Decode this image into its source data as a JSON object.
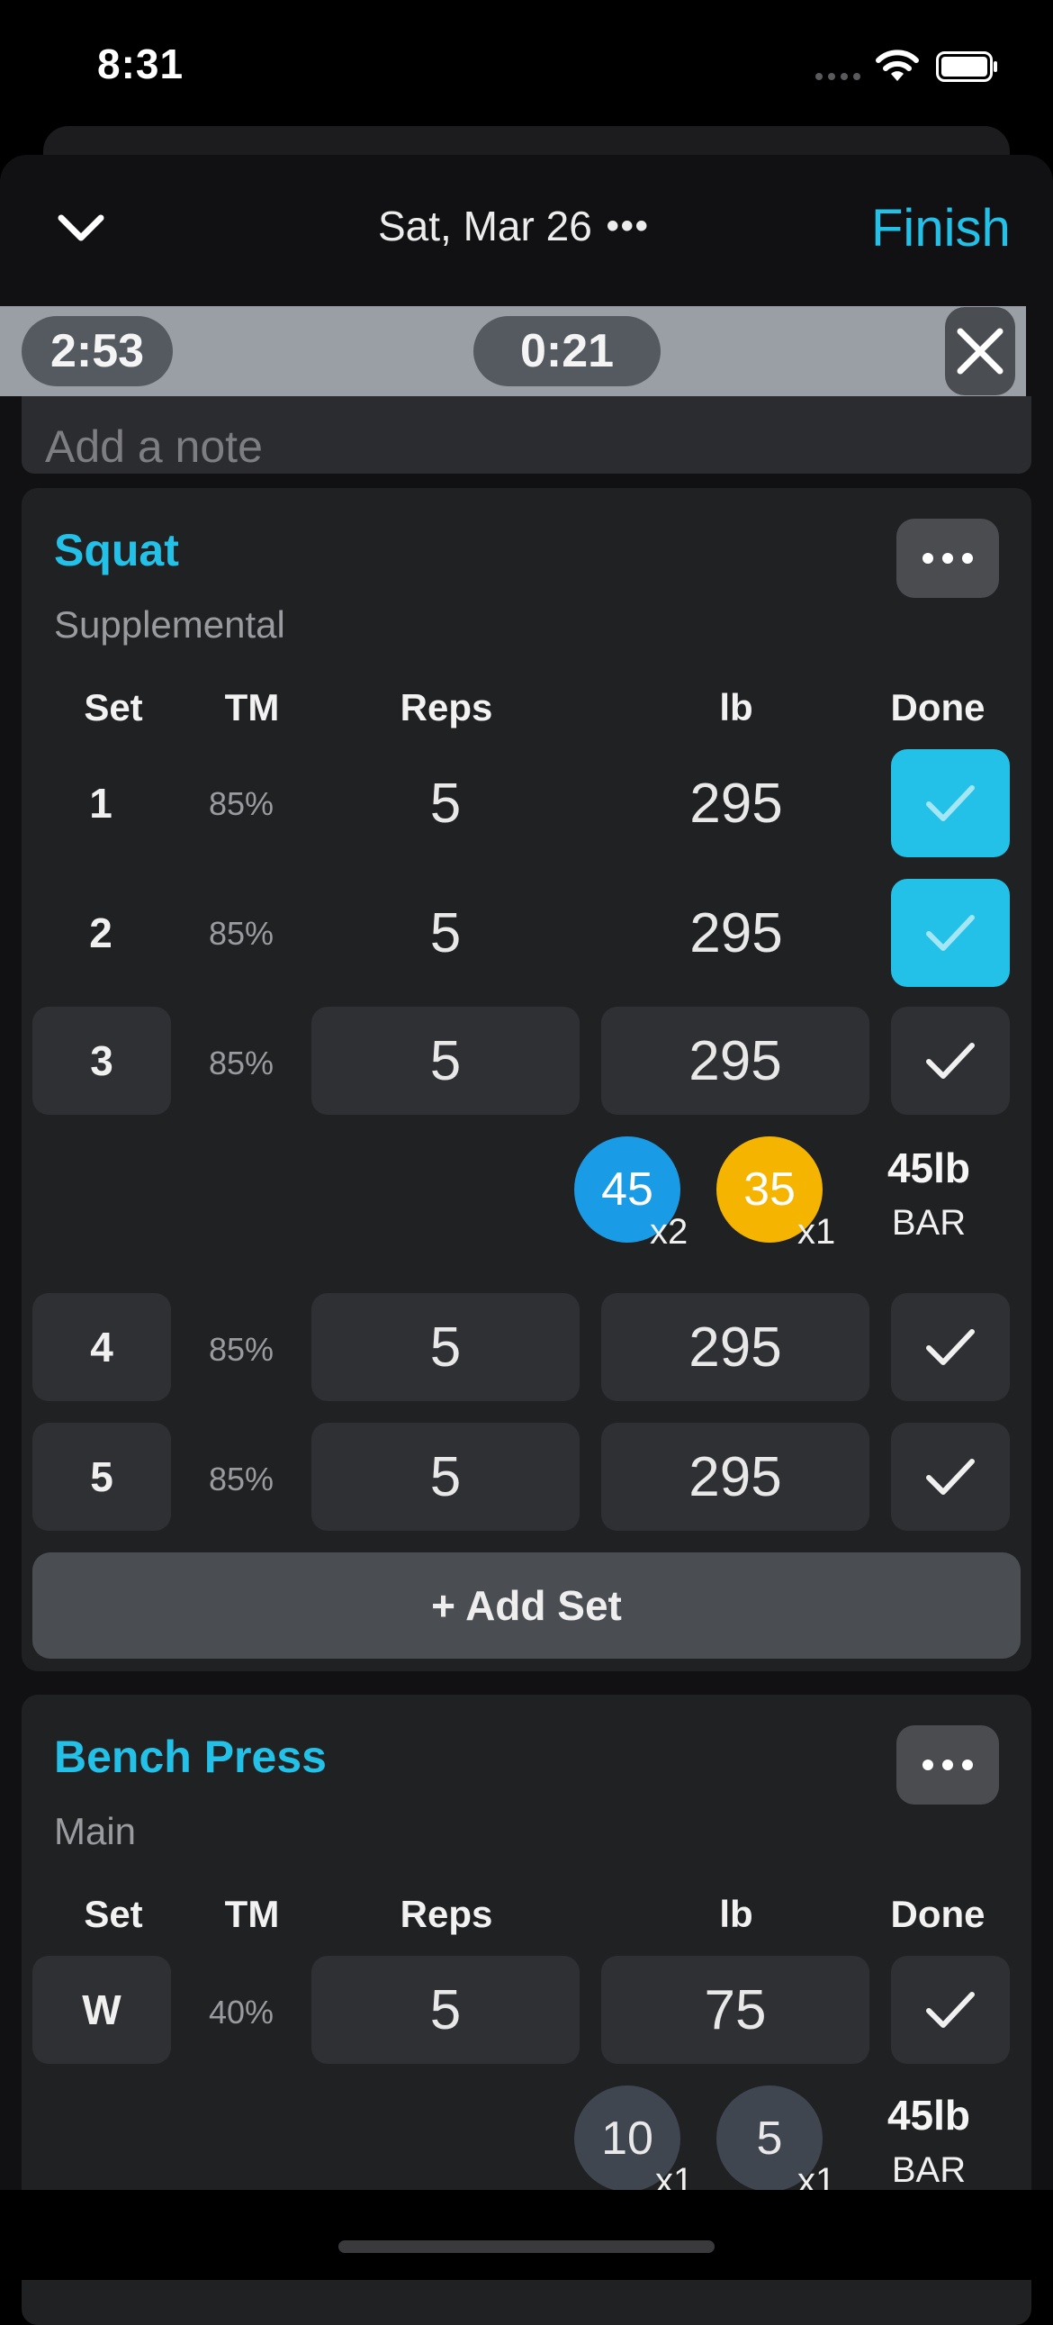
{
  "status": {
    "time": "8:31"
  },
  "header": {
    "date": "Sat, Mar 26",
    "more_glyph": "•••",
    "finish_label": "Finish",
    "collapse_icon": "chevron-down-icon"
  },
  "timers": {
    "elapsed": "2:53",
    "rest": "0:21",
    "close_icon": "close-icon"
  },
  "note": {
    "placeholder": "Add a note"
  },
  "columns": {
    "set": "Set",
    "tm": "TM",
    "reps": "Reps",
    "weight": "lb",
    "done": "Done"
  },
  "exercises": [
    {
      "name": "Squat",
      "type": "Supplemental",
      "sets": [
        {
          "set": "1",
          "tm": "85%",
          "reps": "5",
          "weight": "295",
          "done": true
        },
        {
          "set": "2",
          "tm": "85%",
          "reps": "5",
          "weight": "295",
          "done": true
        },
        {
          "set": "3",
          "tm": "85%",
          "reps": "5",
          "weight": "295",
          "done": false
        },
        {
          "set": "4",
          "tm": "85%",
          "reps": "5",
          "weight": "295",
          "done": false
        },
        {
          "set": "5",
          "tm": "85%",
          "reps": "5",
          "weight": "295",
          "done": false
        }
      ],
      "plates": [
        {
          "weight": "45",
          "count": "x2",
          "color": "#1a9be6"
        },
        {
          "weight": "35",
          "count": "x1",
          "color": "#f5b400"
        }
      ],
      "bar": {
        "weight": "45lb",
        "label": "BAR"
      },
      "add_set_label": "+ Add Set"
    },
    {
      "name": "Bench Press",
      "type": "Main",
      "sets": [
        {
          "set": "W",
          "tm": "40%",
          "reps": "5",
          "weight": "75",
          "done": false
        }
      ],
      "plates": [
        {
          "weight": "10",
          "count": "x1",
          "color": "#3f4650"
        },
        {
          "weight": "5",
          "count": "x1",
          "color": "#3f4650"
        }
      ],
      "bar": {
        "weight": "45lb",
        "label": "BAR"
      }
    }
  ],
  "colors": {
    "accent": "#23c1e8",
    "background": "#000000",
    "card": "#202123"
  }
}
